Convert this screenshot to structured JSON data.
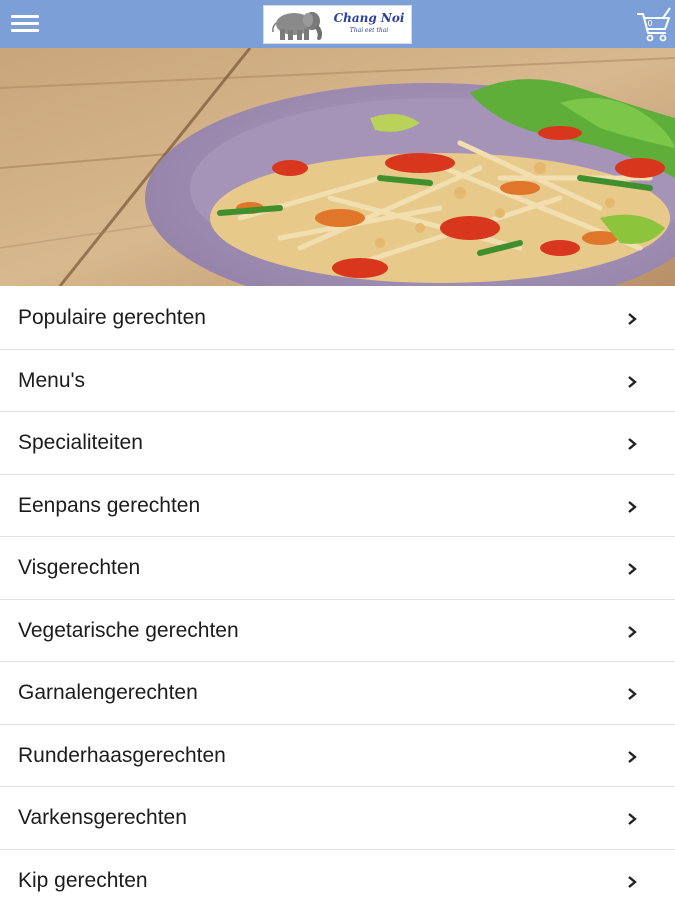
{
  "header": {
    "menu_icon": "hamburger-menu-icon",
    "logo": {
      "title": "Chang Noi",
      "subtitle": "Thai eet thai"
    },
    "cart": {
      "icon": "shopping-cart-icon",
      "count": "0"
    },
    "background_color": "#7b9fd6"
  },
  "hero": {
    "description_icon": "papaya-salad-photo"
  },
  "categories": [
    {
      "label": "Populaire gerechten"
    },
    {
      "label": "Menu's"
    },
    {
      "label": "Specialiteiten"
    },
    {
      "label": "Eenpans gerechten"
    },
    {
      "label": "Visgerechten"
    },
    {
      "label": "Vegetarische gerechten"
    },
    {
      "label": "Garnalengerechten"
    },
    {
      "label": "Runderhaasgerechten"
    },
    {
      "label": "Varkensgerechten"
    },
    {
      "label": "Kip gerechten"
    }
  ]
}
